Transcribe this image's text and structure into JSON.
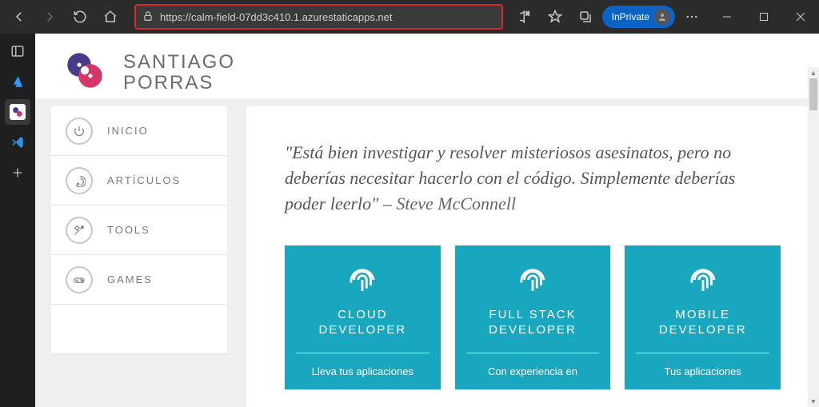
{
  "browser": {
    "url": "https://calm-field-07dd3c410.1.azurestaticapps.net",
    "inprivate_label": "InPrivate"
  },
  "site": {
    "brand_line1": "SANTIAGO",
    "brand_line2": "PORRAS"
  },
  "nav": {
    "items": [
      {
        "label": "INICIO",
        "icon": "power"
      },
      {
        "label": "ARTÍCULOS",
        "icon": "rss"
      },
      {
        "label": "TOOLS",
        "icon": "tools"
      },
      {
        "label": "GAMES",
        "icon": "gamepad"
      }
    ]
  },
  "quote": {
    "text": "\"Está bien investigar y resolver misteriosos asesinatos, pero no deberías necesitar hacerlo con el código. Simplemente deberías poder leerlo\" – ",
    "author": "Steve McConnell"
  },
  "cards": [
    {
      "title_l1": "CLOUD",
      "title_l2": "DEVELOPER",
      "desc": "Lleva tus aplicaciones"
    },
    {
      "title_l1": "FULL STACK",
      "title_l2": "DEVELOPER",
      "desc": "Con experiencia en"
    },
    {
      "title_l1": "MOBILE",
      "title_l2": "DEVELOPER",
      "desc": "Tus aplicaciones"
    }
  ]
}
